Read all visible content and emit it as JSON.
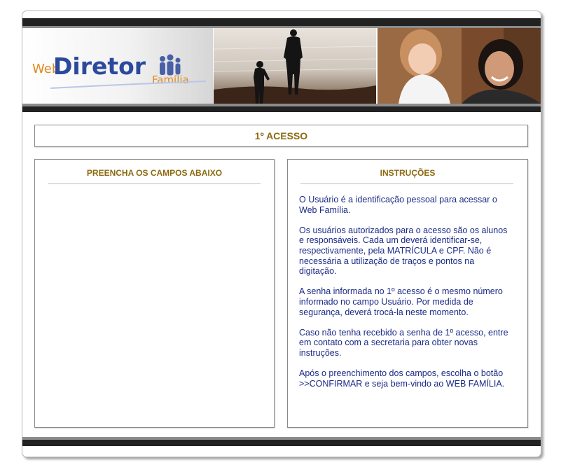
{
  "header": {
    "logo": {
      "web_text": "Web",
      "brand_text": "Diretor",
      "sub_text": "Família"
    }
  },
  "title": "1º ACESSO",
  "left_panel": {
    "title": "PREENCHA OS CAMPOS ABAIXO"
  },
  "right_panel": {
    "title": "INSTRUÇÕES",
    "paragraphs": [
      "O Usuário é a identificação pessoal para acessar o\nWeb Família.",
      "Os usuários autorizados para o acesso são os alunos\ne responsáveis. Cada um deverá identificar-se,\nrespectivamente, pela MATRÍCULA e CPF. Não é\nnecessária a utilização de traços e pontos na\ndigitação.",
      "A senha informada no 1º acesso é o mesmo número\ninformado no campo Usuário. Por medida de\nsegurança, deverá trocá-la neste momento.",
      "Caso não tenha recebido a senha de 1º acesso, entre\nem contato com a secretaria para obter novas\n instruções.",
      "Após o preenchimento dos campos, escolha o botão\n >>CONFIRMAR e seja bem-vindo ao WEB FAMÍLIA."
    ]
  },
  "colors": {
    "heading": "#8c6a10",
    "body_text": "#1a2a86",
    "logo_blue": "#2c4a9c",
    "logo_orange": "#e08a1c",
    "bar_dark": "#222222",
    "bar_gray": "#8c8c8c"
  }
}
